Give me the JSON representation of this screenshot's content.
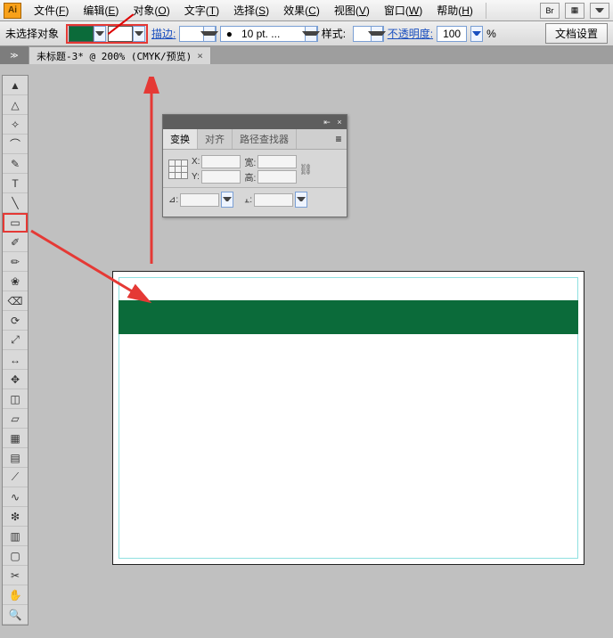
{
  "menubar": {
    "logo": "Ai",
    "items": [
      {
        "label": "文件",
        "key": "F"
      },
      {
        "label": "编辑",
        "key": "E"
      },
      {
        "label": "对象",
        "key": "O"
      },
      {
        "label": "文字",
        "key": "T"
      },
      {
        "label": "选择",
        "key": "S"
      },
      {
        "label": "效果",
        "key": "C"
      },
      {
        "label": "视图",
        "key": "V"
      },
      {
        "label": "窗口",
        "key": "W"
      },
      {
        "label": "帮助",
        "key": "H"
      }
    ],
    "bridge_btn": "Br"
  },
  "ctrlbar": {
    "no_selection": "未选择对象",
    "stroke_label": "描边:",
    "stroke_weight": "10 pt. ...",
    "style_label": "样式:",
    "opacity_label": "不透明度:",
    "opacity_value": "100",
    "percent": "%",
    "doc_setup": "文档设置"
  },
  "tab": {
    "title": "未标题-3* @ 200% (CMYK/预览)"
  },
  "toolbox": [
    "selection",
    "direct-select",
    "magic-wand",
    "lasso",
    "pen",
    "type",
    "line",
    "rectangle",
    "paintbrush",
    "pencil",
    "blob-brush",
    "eraser",
    "rotate",
    "scale",
    "width",
    "free-transform",
    "shape-builder",
    "perspective",
    "mesh",
    "gradient",
    "eyedropper",
    "blend",
    "symbol-sprayer",
    "graph",
    "artboard",
    "slice",
    "hand",
    "zoom"
  ],
  "toolbox_highlight_index": 7,
  "panel": {
    "tabs": [
      "变换",
      "对齐",
      "路径查找器"
    ],
    "active_tab": 0,
    "fields": {
      "x_label": "X:",
      "y_label": "Y:",
      "w_label": "宽:",
      "h_label": "高:",
      "angle_label": "⊿:",
      "shear_label": "⫠:"
    },
    "placeholder": ""
  },
  "colors": {
    "fill": "#0b6b3a",
    "highlight": "#e53935",
    "link": "#1a4fbf"
  }
}
